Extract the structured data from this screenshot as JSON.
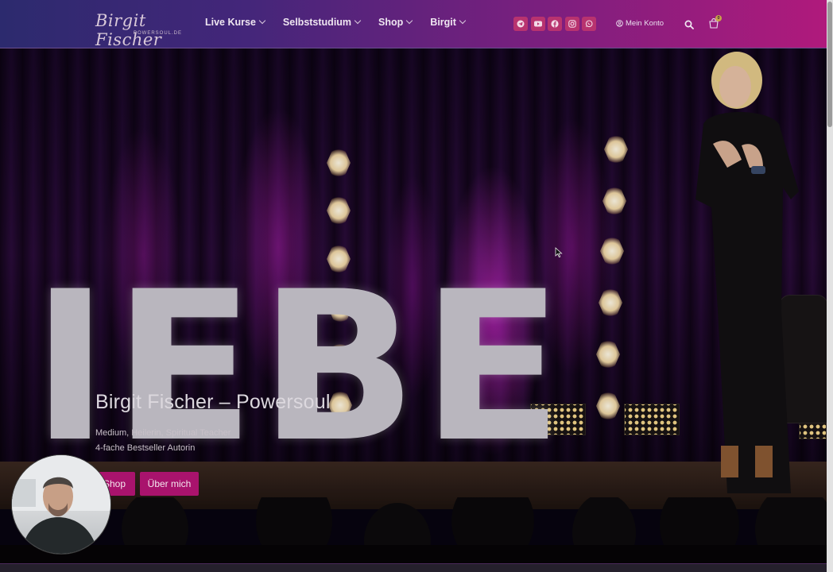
{
  "brand": {
    "logo_text": "Birgit Fischer",
    "logo_subtext": "POWERSOUL.DE"
  },
  "nav": {
    "items": [
      {
        "label": "Live Kurse"
      },
      {
        "label": "Selbststudium"
      },
      {
        "label": "Shop"
      },
      {
        "label": "Birgit"
      }
    ]
  },
  "socials": [
    {
      "icon": "telegram-icon"
    },
    {
      "icon": "youtube-icon"
    },
    {
      "icon": "facebook-icon"
    },
    {
      "icon": "instagram-icon"
    },
    {
      "icon": "whatsapp-icon"
    }
  ],
  "header": {
    "account_label": "Mein Konto",
    "cart_count": "0"
  },
  "hero": {
    "stage_letters": "IEBE",
    "title": "Birgit Fischer – Powersoul",
    "subtitle_line1": "Medium, Heilerin, Spiritual Teacher",
    "subtitle_line2": "4-fache Bestseller Autorin",
    "button_shop": "Shop",
    "button_about": "Über mich"
  },
  "colors": {
    "header_start": "#2c2a6e",
    "header_end": "#b01a7c",
    "accent": "#a9136d",
    "social_bg": "#b8336f"
  }
}
